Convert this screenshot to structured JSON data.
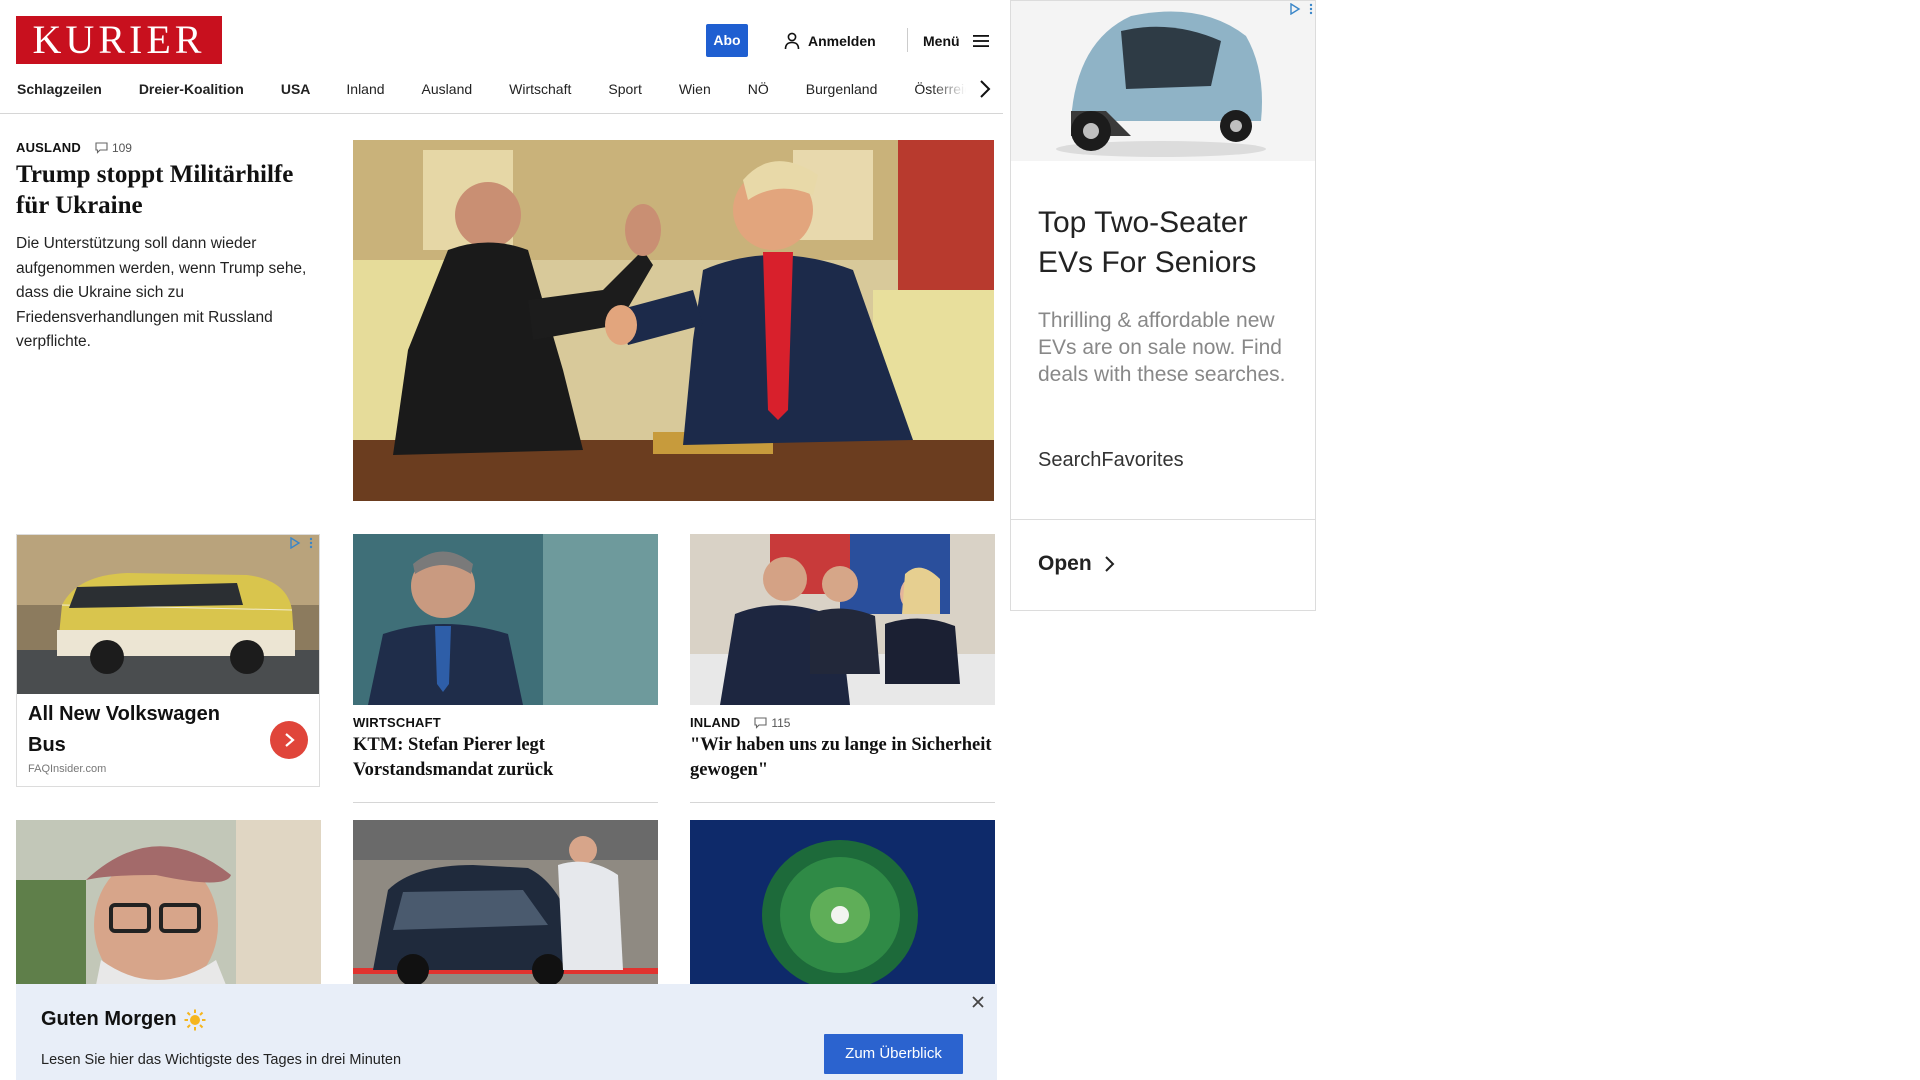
{
  "header": {
    "logo_text": "KURIER",
    "abo_label": "Abo",
    "login_label": "Anmelden",
    "menu_label": "Menü",
    "brand_color": "#c8101e",
    "accent_color": "#1f5fd1"
  },
  "nav": {
    "items": [
      "Schlagzeilen",
      "Dreier-Koalition",
      "USA",
      "Inland",
      "Ausland",
      "Wirtschaft",
      "Sport",
      "Wien",
      "NÖ",
      "Burgenland",
      "Österreich"
    ]
  },
  "lead": {
    "section": "AUSLAND",
    "comments": "109",
    "headline": "Trump stoppt Militärhilfe für Ukraine",
    "teaser": "Die Unterstützung soll dann wieder aufgenommen werden, wenn Trump sehe, dass die Ukraine sich zu Friedensverhandlungen mit Russland verpflichte."
  },
  "infeed_ad": {
    "title": "All New Volkswagen Bus",
    "source": "FAQInsider.com"
  },
  "cards": [
    {
      "section": "WIRTSCHAFT",
      "comments": "",
      "headline": "KTM: Stefan Pierer legt Vorstandsmandat zurück"
    },
    {
      "section": "INLAND",
      "comments": "115",
      "headline": "\"Wir haben uns zu lange in Sicherheit gewogen\""
    }
  ],
  "side_ad": {
    "title": "Top Two-Seater EVs For Seniors",
    "body": "Thrilling & affordable new EVs are on sale now. Find deals with these searches.",
    "source": "SearchFavorites",
    "open_label": "Open"
  },
  "banner": {
    "title": "Guten Morgen",
    "text": "Lesen Sie hier das Wichtigste des Tages in drei Minuten",
    "button_label": "Zum Überblick"
  }
}
